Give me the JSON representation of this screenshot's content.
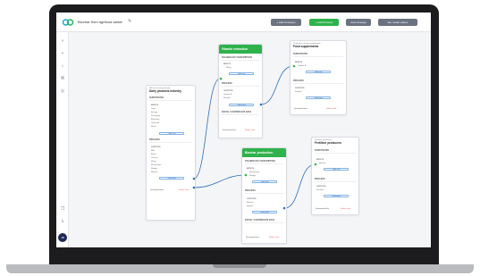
{
  "app": {
    "title": "Biochar from agrifood waste",
    "edit_icon": "✎",
    "buttons": [
      {
        "label": "+ Add Company",
        "color": "#6b7280"
      },
      {
        "label": "+ Add Process",
        "color": "#2fb24c"
      },
      {
        "label": "Auto arrange",
        "color": "#6b7280"
      },
      {
        "label": "Set model values",
        "color": "#6b7280"
      }
    ],
    "avatar": "JB"
  },
  "rail_icons": [
    "chevron-icon",
    "plus-icon",
    "bulb-icon",
    "network-icon",
    "database-icon",
    "copy-icon",
    "route-icon"
  ],
  "cards": {
    "dairy": {
      "subtitle": "Milk processing industry",
      "title": "Dairy products industry",
      "section_a": "SUBSTRATES",
      "inputs_label": "INPUTS",
      "inputs": [
        "Land",
        "Energy",
        "Packaging",
        "Electricity",
        "Chemical",
        "Water"
      ],
      "add_input": "+ Add input",
      "section_b": "PROCESS",
      "outputs_label": "OUTPUTS",
      "outputs": [
        "Milk",
        "Butter",
        "Cheese",
        "Whey",
        "Wastewater",
        "Sludge",
        "Manure"
      ],
      "add_output": "+ Add output",
      "doc_label": "Document links",
      "delete_label": "Delete card"
    },
    "vitamin": {
      "title": "Vitamin extraction",
      "section_a": "TECHNOLOGY DESCRIPTION",
      "inputs_label": "INPUTS",
      "inputs": [
        "Whey"
      ],
      "add_input": "+ Add input",
      "section_b": "PROCESS",
      "outputs_label": "OUTPUTS",
      "outputs": [
        "Vitamin B",
        "Residue"
      ],
      "add_output": "+ Add output",
      "section_c": "BATCH / CONTINUOUS DATA",
      "doc_label": "Document links",
      "delete_label": "Delete card"
    },
    "food": {
      "subtitle": "Production of food supplements",
      "title": "Food supplements",
      "section_a": "SUBSTRATES",
      "inputs_label": "INPUTS",
      "inputs": [
        "Vitamin B"
      ],
      "add_input": "+ Add input",
      "section_b": "PROCESS",
      "outputs_label": "OUTPUTS",
      "outputs": [
        "Product"
      ],
      "add_output": "+ Add output",
      "doc_label": "Document links",
      "delete_label": "Delete card"
    },
    "biochar": {
      "title": "Biochar production",
      "section_a": "TECHNOLOGY DESCRIPTION",
      "inputs_label": "INPUTS",
      "inputs": [
        "Wastewater",
        "Sludge"
      ],
      "add_input": "+ Add input",
      "section_b": "PROCESS",
      "outputs_label": "OUTPUTS",
      "outputs": [
        "Biochar",
        "Syngas"
      ],
      "add_output": "+ Add output",
      "section_c": "BATCH / CONTINUOUS DATA",
      "doc_label": "Document links",
      "delete_label": "Delete card"
    },
    "fertiliser": {
      "subtitle": "Fertiliser production",
      "title": "Fertiliser producers",
      "section_a": "SUBSTRATES",
      "inputs_label": "INPUTS",
      "inputs": [
        "Biochar"
      ],
      "add_input": "+ Add input",
      "section_b": "PROCESS",
      "outputs_label": "OUTPUTS",
      "outputs": [
        "Fertiliser"
      ],
      "add_output": "+ Add output",
      "doc_label": "Document links",
      "delete_label": "Delete card"
    }
  }
}
